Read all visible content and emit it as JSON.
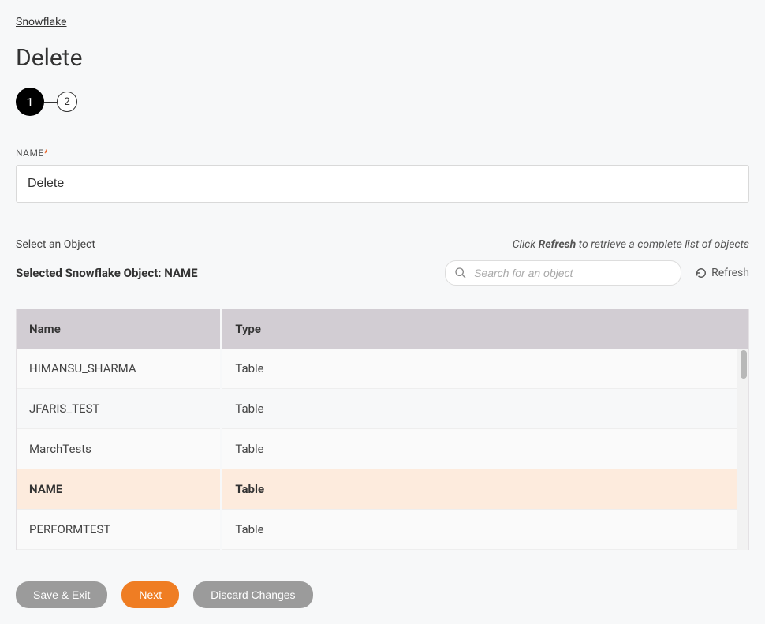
{
  "breadcrumb": "Snowflake",
  "page_title": "Delete",
  "stepper": {
    "step1": "1",
    "step2": "2"
  },
  "name_field": {
    "label": "NAME",
    "value": "Delete"
  },
  "object_section": {
    "select_label": "Select an Object",
    "refresh_hint_prefix": "Click ",
    "refresh_hint_bold": "Refresh",
    "refresh_hint_suffix": " to retrieve a complete list of objects",
    "selected_prefix": "Selected Snowflake Object: ",
    "selected_value": "NAME",
    "search_placeholder": "Search for an object",
    "refresh_label": "Refresh"
  },
  "table": {
    "headers": {
      "name": "Name",
      "type": "Type"
    },
    "rows": [
      {
        "name": "HIMANSU_SHARMA",
        "type": "Table",
        "alt": true,
        "selected": false
      },
      {
        "name": "JFARIS_TEST",
        "type": "Table",
        "alt": false,
        "selected": false
      },
      {
        "name": "MarchTests",
        "type": "Table",
        "alt": true,
        "selected": false
      },
      {
        "name": "NAME",
        "type": "Table",
        "alt": false,
        "selected": true
      },
      {
        "name": "PERFORMTEST",
        "type": "Table",
        "alt": true,
        "selected": false
      }
    ]
  },
  "buttons": {
    "save_exit": "Save & Exit",
    "next": "Next",
    "discard": "Discard Changes"
  }
}
